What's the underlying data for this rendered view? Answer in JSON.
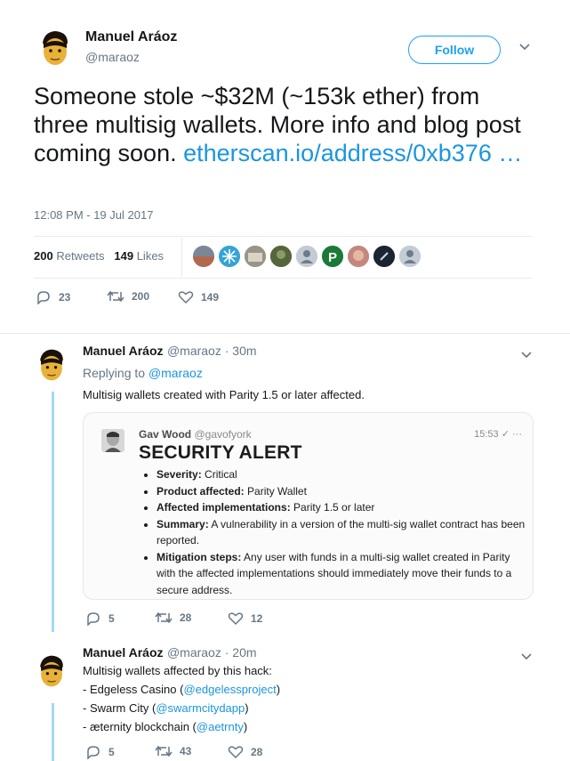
{
  "main_tweet": {
    "author_name": "Manuel Aráoz",
    "author_handle": "@maraoz",
    "follow_label": "Follow",
    "text": "Someone stole ~$32M (~153k ether) from three multisig wallets. More info and blog post coming soon.",
    "link_text": "etherscan.io/address/0xb376 …",
    "timestamp": "12:08 PM - 19 Jul 2017",
    "retweets_count": "200",
    "retweets_label": "Retweets",
    "likes_count": "149",
    "likes_label": "Likes",
    "replies": "23",
    "retweets": "200",
    "likes": "149"
  },
  "reply1": {
    "author_name": "Manuel Aráoz",
    "meta": "@maraoz · 30m",
    "replying_prefix": "Replying to",
    "replying_to": "@maraoz",
    "text": "Multisig wallets created with Parity 1.5 or later affected.",
    "media": {
      "name": "Gav Wood",
      "handle": "@gavofyork",
      "time": "15:53 ✓ ···",
      "title": "SECURITY ALERT",
      "items": [
        {
          "label": "Severity:",
          "text": " Critical"
        },
        {
          "label": "Product affected:",
          "text": " Parity Wallet"
        },
        {
          "label": "Affected implementations:",
          "text": " Parity 1.5 or later"
        },
        {
          "label": "Summary:",
          "text": " A vulnerability in a version of the multi-sig wallet contract has been reported."
        },
        {
          "label": "Mitigation steps:",
          "text": " Any user with funds in a multi-sig wallet created in Parity with the affected implementations should immediately move their funds to a secure address."
        }
      ]
    },
    "replies": "5",
    "retweets": "28",
    "likes": "12"
  },
  "reply2": {
    "author_name": "Manuel Aráoz",
    "meta": "@maraoz · 20m",
    "line1": "Multisig wallets affected by this hack:",
    "items": [
      {
        "prefix": "- Edgeless Casino (",
        "mention": "@edgelessproject",
        "suffix": ")"
      },
      {
        "prefix": "- Swarm City (",
        "mention": "@swarmcitydapp",
        "suffix": ")"
      },
      {
        "prefix": "- æternity blockchain (",
        "mention": "@aetrnty",
        "suffix": ")"
      }
    ],
    "replies": "5",
    "retweets": "43",
    "likes": "28"
  },
  "colors": {
    "link": "#1b95e0",
    "follow": "#1da1f2",
    "thread_line": "#a3d8f4",
    "muted": "#657786"
  },
  "icons": [
    "caret-down-icon",
    "reply-icon",
    "retweet-icon",
    "heart-icon",
    "check-icon",
    "more-icon"
  ]
}
